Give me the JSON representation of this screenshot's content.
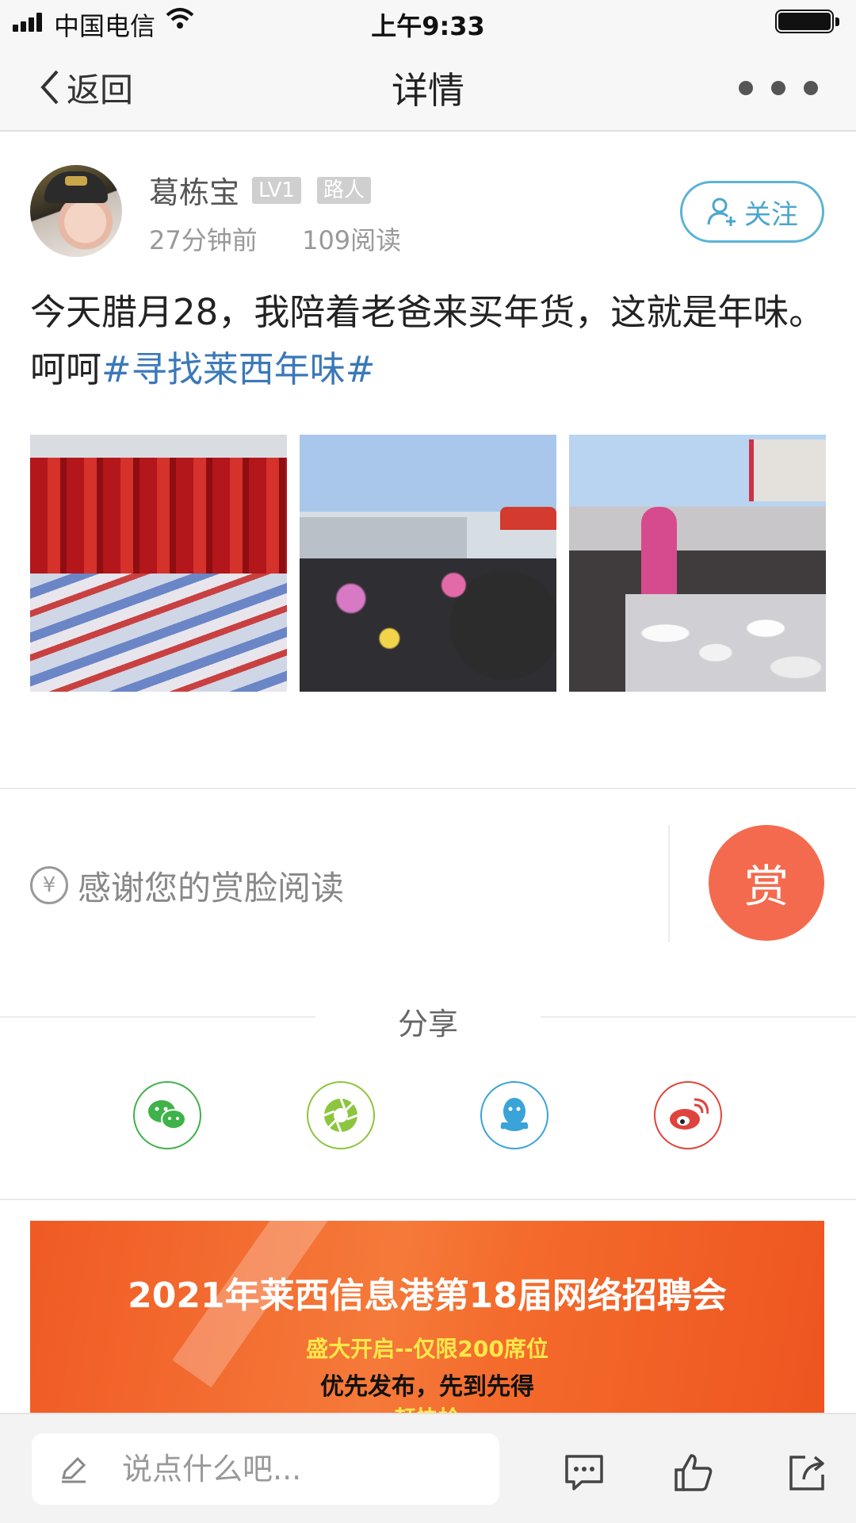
{
  "status_bar": {
    "carrier": "中国电信",
    "time": "上午9:33"
  },
  "nav": {
    "back_label": "返回",
    "title": "详情"
  },
  "post": {
    "username": "葛栋宝",
    "level_badge": "LV1",
    "rank_badge": "路人",
    "time_ago": "27分钟前",
    "read_count": "109阅读",
    "follow_label": "关注",
    "text": "今天腊月28，我陪着老爸来买年货，这就是年味。呵呵",
    "hashtag": "#寻找莱西年味#",
    "image_count": 3
  },
  "reward": {
    "thanks_text": "感谢您的赏脸阅读",
    "yen_symbol": "¥",
    "button_label": "赏"
  },
  "share": {
    "title": "分享",
    "targets": [
      {
        "name": "wechat",
        "color": "#3fb24a"
      },
      {
        "name": "moments",
        "color": "#8cc63e"
      },
      {
        "name": "qq",
        "color": "#3aa3d8"
      },
      {
        "name": "weibo",
        "color": "#e0433b"
      }
    ]
  },
  "banner": {
    "headline": "2021年莱西信息港第18届网络招聘会",
    "line1": "盛大开启--仅限200席位",
    "line2": "优先发布，先到先得",
    "line3": "赶快抢"
  },
  "bottom_bar": {
    "comment_placeholder": "说点什么吧..."
  }
}
